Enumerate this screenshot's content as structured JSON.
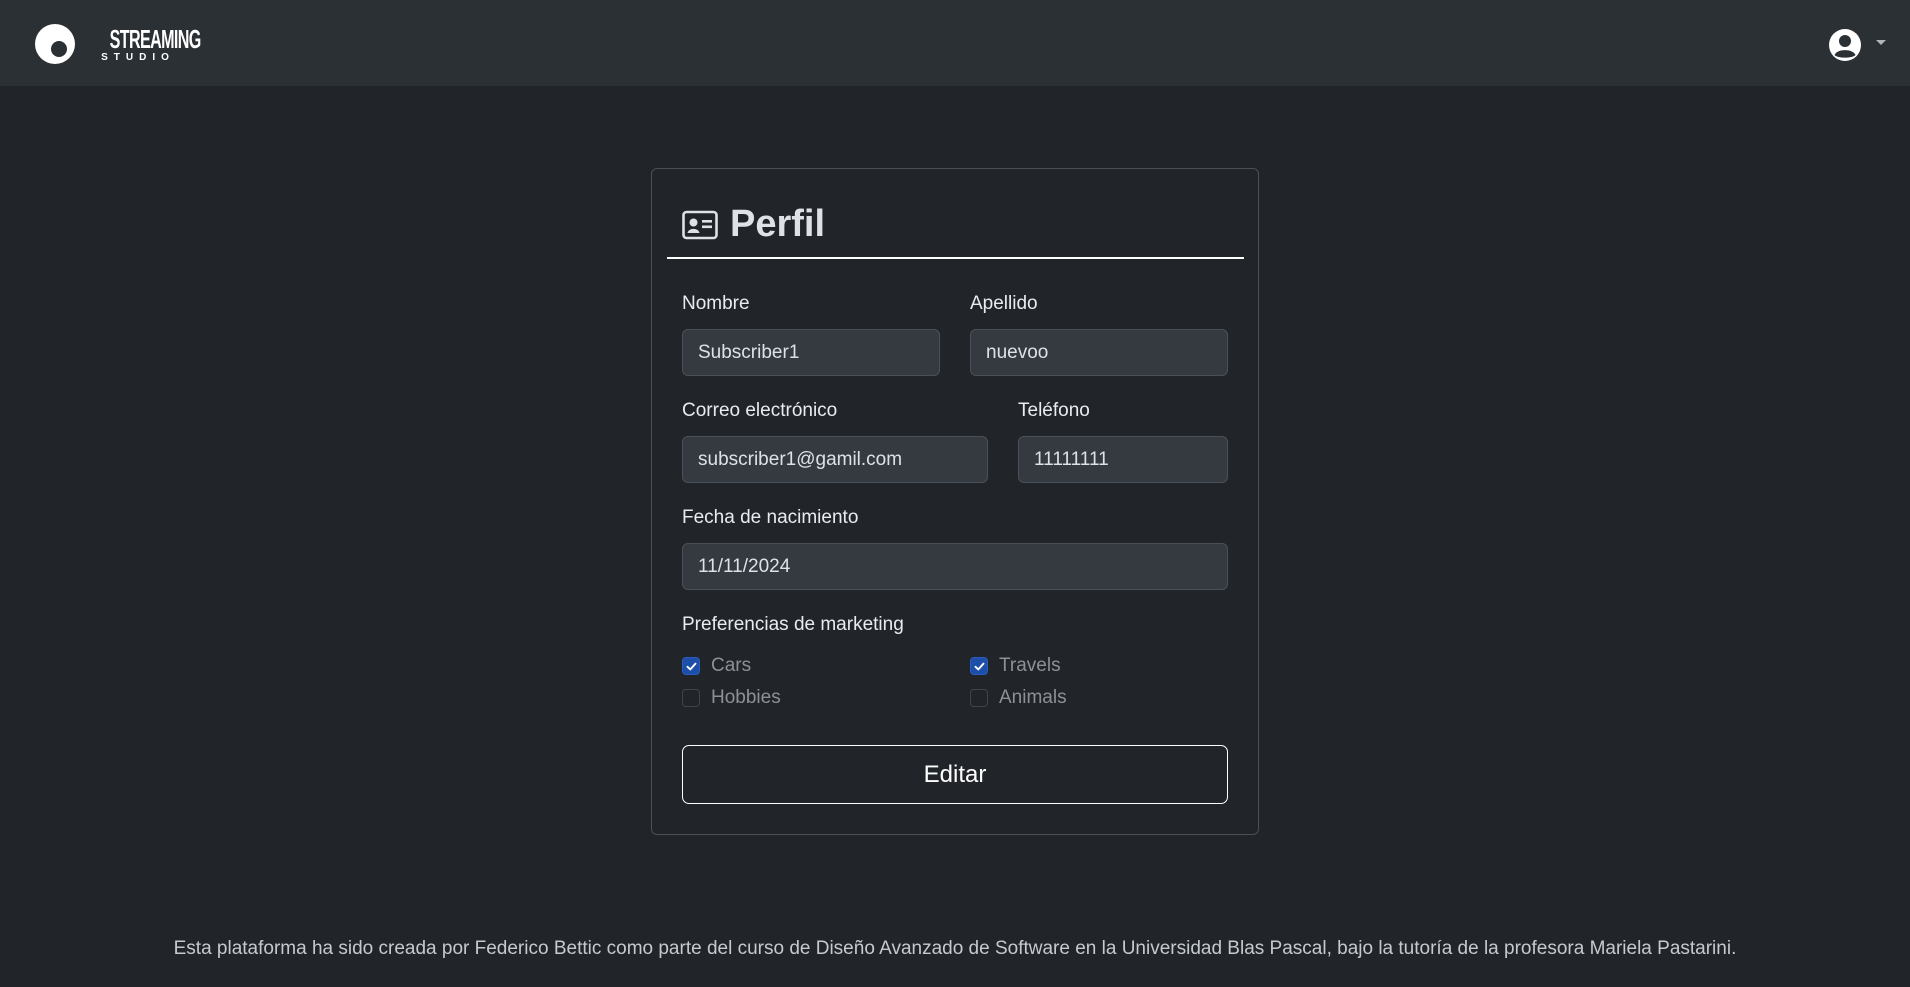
{
  "navbar": {
    "brand_top": "STREAMING",
    "brand_bottom": "STUDIO",
    "user_icon": "user-circle-icon",
    "dropdown_icon": "caret-down-icon"
  },
  "profile": {
    "icon": "id-card-icon",
    "title": "Perfil",
    "fields": {
      "nombre": {
        "label": "Nombre",
        "value": "Subscriber1"
      },
      "apellido": {
        "label": "Apellido",
        "value": "nuevoo"
      },
      "correo": {
        "label": "Correo electrónico",
        "value": "subscriber1@gamil.com"
      },
      "telefono": {
        "label": "Teléfono",
        "value": "11111111"
      },
      "fecha": {
        "label": "Fecha de nacimiento",
        "value": "11/11/2024"
      }
    },
    "marketing": {
      "label": "Preferencias de marketing",
      "options": [
        {
          "label": "Cars",
          "checked": true
        },
        {
          "label": "Travels",
          "checked": true
        },
        {
          "label": "Hobbies",
          "checked": false
        },
        {
          "label": "Animals",
          "checked": false
        }
      ]
    },
    "edit_label": "Editar"
  },
  "footer": {
    "text": "Esta plataforma ha sido creada por Federico Bettic como parte del curso de Diseño Avanzado de Software en la Universidad Blas Pascal, bajo la tutoría de la profesora Mariela Pastarini."
  },
  "colors": {
    "background": "#212529",
    "navbar": "#2b3035",
    "input_bg": "#343a40",
    "checkbox_checked": "#1e4fa8"
  }
}
